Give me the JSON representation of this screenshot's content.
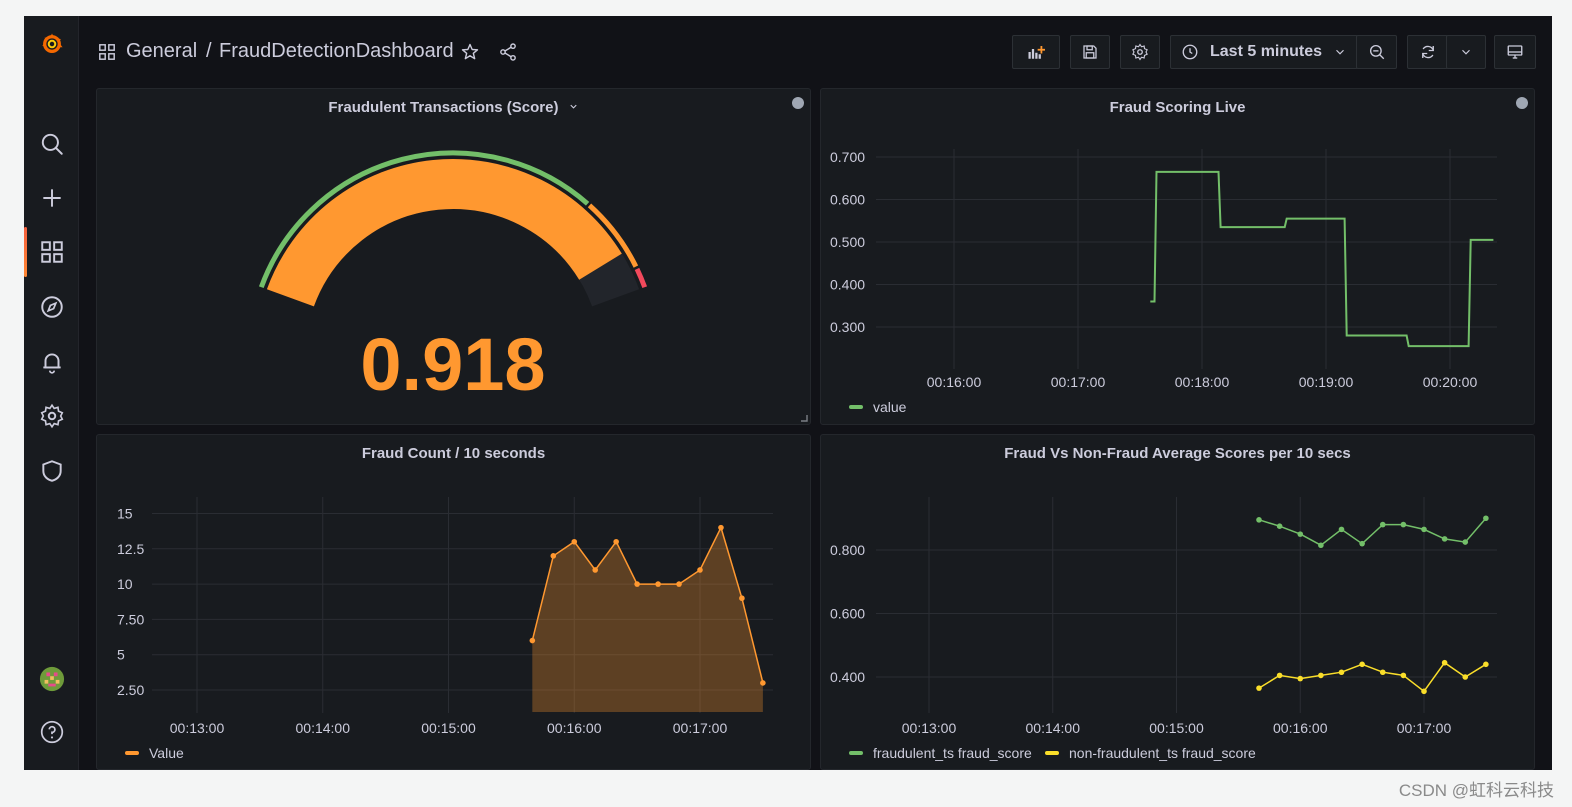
{
  "breadcrumb": {
    "folder": "General",
    "separator": "/",
    "dashboard": "FraudDetectionDashboard"
  },
  "time_picker": {
    "label": "Last 5 minutes"
  },
  "sidebar": {
    "items": [
      "search-icon",
      "plus-icon",
      "dashboards-icon",
      "explore-icon",
      "alerting-icon",
      "configuration-icon",
      "server-admin-icon"
    ],
    "active": "dashboards-icon",
    "bottom": [
      "profile-avatar",
      "help-icon"
    ]
  },
  "panels": {
    "gauge": {
      "title": "Fraudulent Transactions (Score)",
      "value": "0.918",
      "fraction": 0.918
    },
    "live": {
      "title": "Fraud Scoring Live",
      "legend": "value"
    },
    "count": {
      "title": "Fraud Count / 10 seconds",
      "legend": "Value"
    },
    "avg": {
      "title": "Fraud Vs Non-Fraud Average Scores per 10 secs",
      "legend": [
        "fraudulent_ts fraud_score",
        "non-fraudulent_ts fraud_score"
      ]
    }
  },
  "colors": {
    "accent": "#ff9830",
    "green": "#73bf69",
    "yellow": "#fade2a",
    "red": "#f2495c",
    "background": "#111217",
    "panel": "#181b1f"
  },
  "watermark": "CSDN @虹科云科技",
  "chart_data": [
    {
      "type": "line",
      "title": "Fraud Scoring Live",
      "x_ticks": [
        "00:16:00",
        "00:17:00",
        "00:18:00",
        "00:19:00",
        "00:20:00"
      ],
      "y_ticks": [
        "0.700",
        "0.600",
        "0.500",
        "0.400",
        "0.300"
      ],
      "ylim": [
        0.25,
        0.72
      ],
      "step": true,
      "series": [
        {
          "name": "value",
          "color": "#73bf69",
          "points": [
            [
              "00:17:35",
              0.36
            ],
            [
              "00:17:37",
              0.36
            ],
            [
              "00:17:38",
              0.665
            ],
            [
              "00:18:08",
              0.665
            ],
            [
              "00:18:09",
              0.535
            ],
            [
              "00:18:40",
              0.535
            ],
            [
              "00:18:41",
              0.555
            ],
            [
              "00:19:09",
              0.555
            ],
            [
              "00:19:10",
              0.28
            ],
            [
              "00:19:39",
              0.28
            ],
            [
              "00:19:40",
              0.255
            ],
            [
              "00:20:09",
              0.255
            ],
            [
              "00:20:10",
              0.505
            ],
            [
              "00:20:21",
              0.505
            ]
          ]
        }
      ]
    },
    {
      "type": "area",
      "title": "Fraud Count / 10 seconds",
      "x_ticks": [
        "00:13:00",
        "00:14:00",
        "00:15:00",
        "00:16:00",
        "00:17:00"
      ],
      "y_ticks": [
        "15",
        "12.5",
        "10",
        "7.50",
        "5",
        "2.50"
      ],
      "ylim": [
        0.5,
        15.5
      ],
      "series": [
        {
          "name": "Value",
          "color": "#ff9830",
          "x": [
            "00:15:40",
            "00:15:50",
            "00:16:00",
            "00:16:10",
            "00:16:20",
            "00:16:30",
            "00:16:40",
            "00:16:50",
            "00:17:00",
            "00:17:10",
            "00:17:20",
            "00:17:30"
          ],
          "values": [
            6,
            12,
            13,
            11,
            13,
            10,
            10,
            10,
            11,
            14,
            9,
            3
          ]
        }
      ]
    },
    {
      "type": "line",
      "title": "Fraud Vs Non-Fraud Average Scores per 10 secs",
      "x_ticks": [
        "00:13:00",
        "00:14:00",
        "00:15:00",
        "00:16:00",
        "00:17:00"
      ],
      "y_ticks": [
        "0.800",
        "0.600",
        "0.400"
      ],
      "ylim": [
        0.3,
        0.96
      ],
      "x": [
        "00:15:40",
        "00:15:50",
        "00:16:00",
        "00:16:10",
        "00:16:20",
        "00:16:30",
        "00:16:40",
        "00:16:50",
        "00:17:00",
        "00:17:10",
        "00:17:20",
        "00:17:30"
      ],
      "series": [
        {
          "name": "fraudulent_ts fraud_score",
          "color": "#73bf69",
          "values": [
            0.895,
            0.875,
            0.85,
            0.815,
            0.865,
            0.82,
            0.88,
            0.88,
            0.865,
            0.835,
            0.825,
            0.9
          ]
        },
        {
          "name": "non-fraudulent_ts fraud_score",
          "color": "#fade2a",
          "values": [
            0.365,
            0.405,
            0.395,
            0.405,
            0.415,
            0.44,
            0.415,
            0.405,
            0.355,
            0.445,
            0.4,
            0.44
          ]
        }
      ]
    }
  ]
}
